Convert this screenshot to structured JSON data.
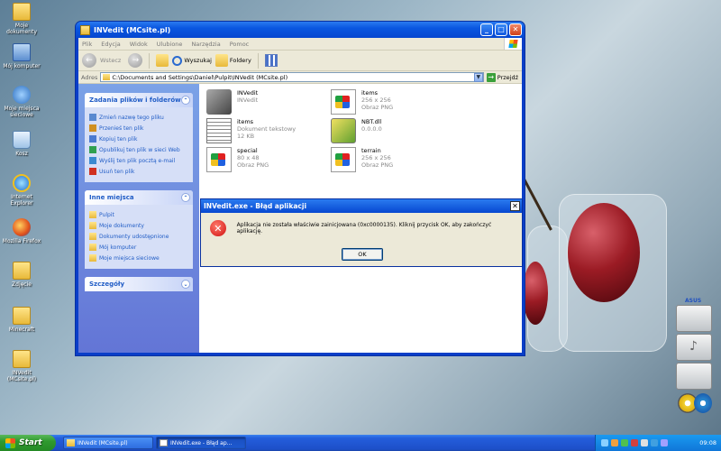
{
  "desktop": {
    "icons": [
      {
        "label": "Moje dokumenty",
        "kind": "folder"
      },
      {
        "label": "Mój komputer",
        "kind": "comp"
      },
      {
        "label": "Moje miejsca sieciowe",
        "kind": "net"
      },
      {
        "label": "Kosz",
        "kind": "bin"
      },
      {
        "label": "Internet Explorer",
        "kind": "ie"
      },
      {
        "label": "Mozilla Firefox",
        "kind": "ff"
      },
      {
        "label": "Zdjęcie",
        "kind": "folder"
      },
      {
        "label": "Minecraft",
        "kind": "folder"
      },
      {
        "label": "INVedit (MCsite.pl)",
        "kind": "folder"
      }
    ]
  },
  "explorer": {
    "title": "INVedit (MCsite.pl)",
    "menu": [
      "Plik",
      "Edycja",
      "Widok",
      "Ulubione",
      "Narzędzia",
      "Pomoc"
    ],
    "toolbar": {
      "back": "Wstecz",
      "search": "Wyszukaj",
      "folders": "Foldery"
    },
    "address": {
      "label": "Adres",
      "path": "C:\\Documents and Settings\\Daniel\\Pulpit\\INVedit (MCsite.pl)",
      "go": "Przejdź"
    },
    "tasks_panel": {
      "title": "Zadania plików i folderów",
      "items": [
        "Zmień nazwę tego pliku",
        "Przenieś ten plik",
        "Kopiuj ten plik",
        "Opublikuj ten plik w sieci Web",
        "Wyślij ten plik pocztą e-mail",
        "Usuń ten plik"
      ]
    },
    "places_panel": {
      "title": "Inne miejsca",
      "items": [
        "Pulpit",
        "Moje dokumenty",
        "Dokumenty udostępnione",
        "Mój komputer",
        "Moje miejsca sieciowe"
      ]
    },
    "details_panel": {
      "title": "Szczegóły"
    },
    "files": [
      {
        "name": "INVedit",
        "line2": "INVedit",
        "line3": "",
        "kind": "exe"
      },
      {
        "name": "items",
        "line2": "256 x 256",
        "line3": "Obraz PNG",
        "kind": "png"
      },
      {
        "name": "items",
        "line2": "Dokument tekstowy",
        "line3": "12 KB",
        "kind": "txt"
      },
      {
        "name": "NBT.dll",
        "line2": "0.0.0.0",
        "line3": "",
        "kind": "dll"
      },
      {
        "name": "special",
        "line2": "80 x 48",
        "line3": "Obraz PNG",
        "kind": "png"
      },
      {
        "name": "terrain",
        "line2": "256 x 256",
        "line3": "Obraz PNG",
        "kind": "png"
      }
    ]
  },
  "dialog": {
    "title": "INVedit.exe - Błąd aplikacji",
    "message": "Aplikacja nie została właściwie zainicjowana (0xc0000135). Kliknij przycisk OK, aby zakończyć aplikację.",
    "ok": "OK"
  },
  "gadget": {
    "brand": "ASUS"
  },
  "taskbar": {
    "start": "Start",
    "buttons": [
      "INVedit (MCsite.pl)",
      "INVedit.exe - Błąd ap..."
    ],
    "clock": "09:08"
  }
}
